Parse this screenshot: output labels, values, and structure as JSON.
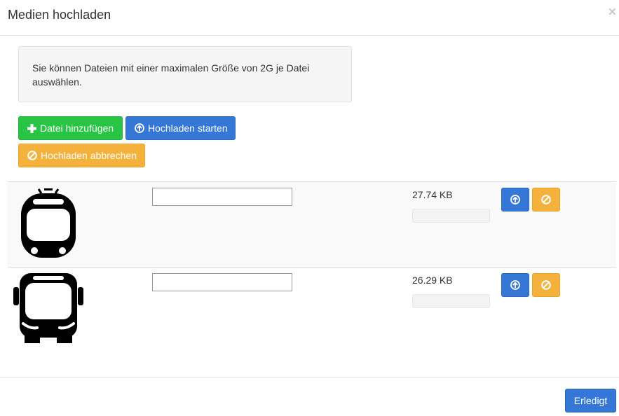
{
  "modal": {
    "title": "Medien hochladen",
    "close_label": "×"
  },
  "info": {
    "text": "Sie können Dateien mit einer maximalen Größe von 2G je Datei auswählen."
  },
  "toolbar": {
    "add_label": "Datei hinzufügen",
    "start_label": "Hochladen starten",
    "cancel_label": "Hochladen abbrechen"
  },
  "files": [
    {
      "thumbnail": "tram-icon",
      "name_value": "",
      "size": "27.74 KB",
      "progress": 0
    },
    {
      "thumbnail": "bus-icon",
      "name_value": "",
      "size": "26.29 KB",
      "progress": 0
    }
  ],
  "footer": {
    "done_label": "Erledigt"
  },
  "colors": {
    "success": "#28c444",
    "primary": "#3477d6",
    "warning": "#f4b13c"
  }
}
